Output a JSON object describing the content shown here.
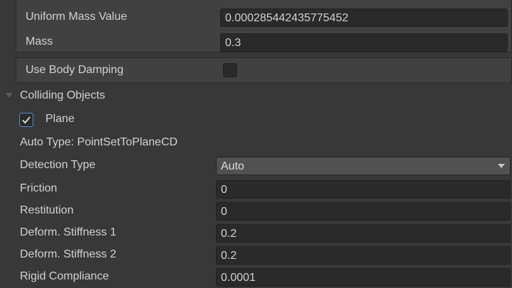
{
  "mass_group": {
    "uniform_mass_value": {
      "label": "Uniform Mass Value",
      "value": "0.000285442435775452"
    },
    "mass": {
      "label": "Mass",
      "value": "0.3"
    }
  },
  "body_damping": {
    "label": "Use Body Damping",
    "checked": false
  },
  "colliding_objects": {
    "header": "Colliding Objects",
    "expanded": true,
    "plane": {
      "label": "Plane",
      "checked": true
    },
    "auto_type": "Auto Type: PointSetToPlaneCD",
    "detection_type": {
      "label": "Detection Type",
      "value": "Auto"
    },
    "friction": {
      "label": "Friction",
      "value": "0"
    },
    "restitution": {
      "label": "Restitution",
      "value": "0"
    },
    "deform_stiffness_1": {
      "label": "Deform. Stiffness 1",
      "value": "0.2"
    },
    "deform_stiffness_2": {
      "label": "Deform. Stiffness 2",
      "value": "0.2"
    },
    "rigid_compliance": {
      "label": "Rigid Compliance",
      "value": "0.0001"
    }
  },
  "colors": {
    "background": "#383838",
    "field_background": "#2a2a2a",
    "checkbox_accent": "#4a8fd8",
    "text": "#d2d2d2"
  }
}
